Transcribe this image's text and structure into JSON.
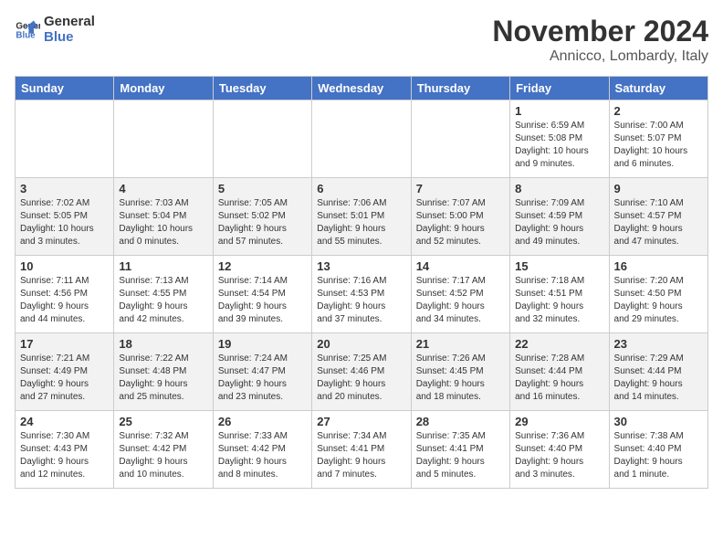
{
  "header": {
    "logo_line1": "General",
    "logo_line2": "Blue",
    "month_title": "November 2024",
    "location": "Annicco, Lombardy, Italy"
  },
  "days_of_week": [
    "Sunday",
    "Monday",
    "Tuesday",
    "Wednesday",
    "Thursday",
    "Friday",
    "Saturday"
  ],
  "weeks": [
    [
      {
        "day": "",
        "info": ""
      },
      {
        "day": "",
        "info": ""
      },
      {
        "day": "",
        "info": ""
      },
      {
        "day": "",
        "info": ""
      },
      {
        "day": "",
        "info": ""
      },
      {
        "day": "1",
        "info": "Sunrise: 6:59 AM\nSunset: 5:08 PM\nDaylight: 10 hours\nand 9 minutes."
      },
      {
        "day": "2",
        "info": "Sunrise: 7:00 AM\nSunset: 5:07 PM\nDaylight: 10 hours\nand 6 minutes."
      }
    ],
    [
      {
        "day": "3",
        "info": "Sunrise: 7:02 AM\nSunset: 5:05 PM\nDaylight: 10 hours\nand 3 minutes."
      },
      {
        "day": "4",
        "info": "Sunrise: 7:03 AM\nSunset: 5:04 PM\nDaylight: 10 hours\nand 0 minutes."
      },
      {
        "day": "5",
        "info": "Sunrise: 7:05 AM\nSunset: 5:02 PM\nDaylight: 9 hours\nand 57 minutes."
      },
      {
        "day": "6",
        "info": "Sunrise: 7:06 AM\nSunset: 5:01 PM\nDaylight: 9 hours\nand 55 minutes."
      },
      {
        "day": "7",
        "info": "Sunrise: 7:07 AM\nSunset: 5:00 PM\nDaylight: 9 hours\nand 52 minutes."
      },
      {
        "day": "8",
        "info": "Sunrise: 7:09 AM\nSunset: 4:59 PM\nDaylight: 9 hours\nand 49 minutes."
      },
      {
        "day": "9",
        "info": "Sunrise: 7:10 AM\nSunset: 4:57 PM\nDaylight: 9 hours\nand 47 minutes."
      }
    ],
    [
      {
        "day": "10",
        "info": "Sunrise: 7:11 AM\nSunset: 4:56 PM\nDaylight: 9 hours\nand 44 minutes."
      },
      {
        "day": "11",
        "info": "Sunrise: 7:13 AM\nSunset: 4:55 PM\nDaylight: 9 hours\nand 42 minutes."
      },
      {
        "day": "12",
        "info": "Sunrise: 7:14 AM\nSunset: 4:54 PM\nDaylight: 9 hours\nand 39 minutes."
      },
      {
        "day": "13",
        "info": "Sunrise: 7:16 AM\nSunset: 4:53 PM\nDaylight: 9 hours\nand 37 minutes."
      },
      {
        "day": "14",
        "info": "Sunrise: 7:17 AM\nSunset: 4:52 PM\nDaylight: 9 hours\nand 34 minutes."
      },
      {
        "day": "15",
        "info": "Sunrise: 7:18 AM\nSunset: 4:51 PM\nDaylight: 9 hours\nand 32 minutes."
      },
      {
        "day": "16",
        "info": "Sunrise: 7:20 AM\nSunset: 4:50 PM\nDaylight: 9 hours\nand 29 minutes."
      }
    ],
    [
      {
        "day": "17",
        "info": "Sunrise: 7:21 AM\nSunset: 4:49 PM\nDaylight: 9 hours\nand 27 minutes."
      },
      {
        "day": "18",
        "info": "Sunrise: 7:22 AM\nSunset: 4:48 PM\nDaylight: 9 hours\nand 25 minutes."
      },
      {
        "day": "19",
        "info": "Sunrise: 7:24 AM\nSunset: 4:47 PM\nDaylight: 9 hours\nand 23 minutes."
      },
      {
        "day": "20",
        "info": "Sunrise: 7:25 AM\nSunset: 4:46 PM\nDaylight: 9 hours\nand 20 minutes."
      },
      {
        "day": "21",
        "info": "Sunrise: 7:26 AM\nSunset: 4:45 PM\nDaylight: 9 hours\nand 18 minutes."
      },
      {
        "day": "22",
        "info": "Sunrise: 7:28 AM\nSunset: 4:44 PM\nDaylight: 9 hours\nand 16 minutes."
      },
      {
        "day": "23",
        "info": "Sunrise: 7:29 AM\nSunset: 4:44 PM\nDaylight: 9 hours\nand 14 minutes."
      }
    ],
    [
      {
        "day": "24",
        "info": "Sunrise: 7:30 AM\nSunset: 4:43 PM\nDaylight: 9 hours\nand 12 minutes."
      },
      {
        "day": "25",
        "info": "Sunrise: 7:32 AM\nSunset: 4:42 PM\nDaylight: 9 hours\nand 10 minutes."
      },
      {
        "day": "26",
        "info": "Sunrise: 7:33 AM\nSunset: 4:42 PM\nDaylight: 9 hours\nand 8 minutes."
      },
      {
        "day": "27",
        "info": "Sunrise: 7:34 AM\nSunset: 4:41 PM\nDaylight: 9 hours\nand 7 minutes."
      },
      {
        "day": "28",
        "info": "Sunrise: 7:35 AM\nSunset: 4:41 PM\nDaylight: 9 hours\nand 5 minutes."
      },
      {
        "day": "29",
        "info": "Sunrise: 7:36 AM\nSunset: 4:40 PM\nDaylight: 9 hours\nand 3 minutes."
      },
      {
        "day": "30",
        "info": "Sunrise: 7:38 AM\nSunset: 4:40 PM\nDaylight: 9 hours\nand 1 minute."
      }
    ]
  ]
}
